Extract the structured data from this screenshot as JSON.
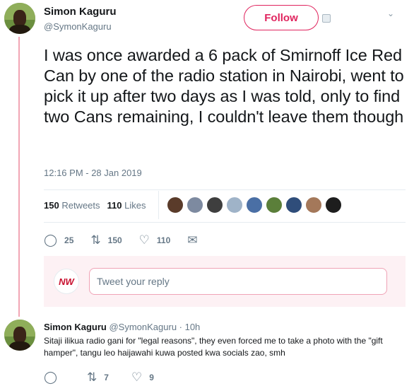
{
  "author": {
    "name": "Simon Kaguru",
    "handle": "@SymonKaguru"
  },
  "follow_label": "Follow",
  "tweet": {
    "text": "I was once awarded a 6 pack of Smirnoff Ice Red Can by one of the radio station in Nairobi, went to pick it up after two days as I was told, only to find two Cans remaining, I couldn't leave them though",
    "timestamp": "12:16 PM - 28 Jan 2019"
  },
  "stats": {
    "retweets_count": "150",
    "retweets_label": "Retweets",
    "likes_count": "110",
    "likes_label": "Likes"
  },
  "actions": {
    "reply_count": "25",
    "retweet_count": "150",
    "like_count": "110"
  },
  "reply_box": {
    "avatar_text": "NW",
    "placeholder": "Tweet your reply"
  },
  "reply": {
    "name": "Simon Kaguru",
    "handle_time": "@SymonKaguru · 10h",
    "text": "Sitaji ilikua radio gani for \"legal reasons\", they even forced me to take a photo with the \"gift hamper\", tangu leo haijawahi kuwa posted kwa socials zao, smh",
    "retweet_count": "7",
    "like_count": "9"
  },
  "colors": {
    "accent": "#e0245e",
    "thread": "#f2a6b5",
    "muted": "#657786"
  },
  "icons": [
    "chevron-down-icon",
    "reply-icon",
    "retweet-icon",
    "heart-icon",
    "message-icon"
  ]
}
